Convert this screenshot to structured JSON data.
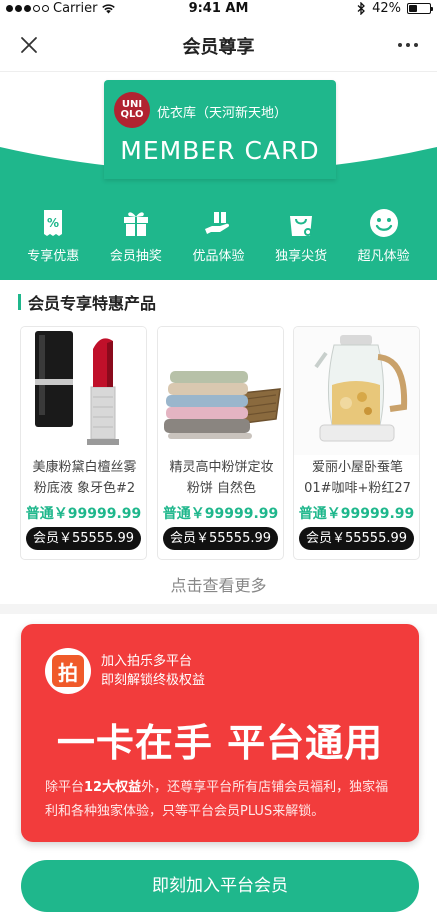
{
  "status_bar": {
    "carrier": "Carrier",
    "time": "9:41 AM",
    "battery": "42%",
    "battery_level": 0.42
  },
  "nav": {
    "title": "会员尊享",
    "close_icon": "close-icon",
    "more_icon": "more-icon"
  },
  "hero": {
    "brand_logo_line1": "UNI",
    "brand_logo_line2": "QLO",
    "store_name": "优衣库（天河新天地）",
    "card_title": "MEMBER CARD",
    "accent_color": "#1fb78c",
    "benefits": [
      {
        "icon": "discount-icon",
        "label": "专享优惠"
      },
      {
        "icon": "gift-icon",
        "label": "会员抽奖"
      },
      {
        "icon": "hand-gift-icon",
        "label": "优品体验"
      },
      {
        "icon": "shopping-bag-icon",
        "label": "独享尖货"
      },
      {
        "icon": "smile-icon",
        "label": "超凡体验"
      }
    ]
  },
  "products_section": {
    "title": "会员专享特惠产品",
    "see_more": "点击查看更多",
    "products": [
      {
        "image": "lipstick",
        "name": "美康粉黛白檀丝雾粉底液 象牙色#2",
        "regular_price": "普通￥99999.99",
        "member_price": "会员￥55555.99"
      },
      {
        "image": "towels",
        "name": "精灵高中粉饼定妆粉饼 自然色",
        "regular_price": "普通￥99999.99",
        "member_price": "会员￥55555.99"
      },
      {
        "image": "kettle",
        "name": "爱丽小屋卧蚕笔01#咖啡+粉红27",
        "regular_price": "普通￥99999.99",
        "member_price": "会员￥55555.99"
      }
    ]
  },
  "promo": {
    "logo_char": "拍",
    "intro_line1": "加入拍乐多平台",
    "intro_line2": "即刻解锁终极权益",
    "slogan": "一卡在手 平台通用",
    "desc_prefix": "除平台",
    "desc_highlight": "12大权益",
    "desc_rest": "外，还尊享平台所有店铺会员福利，独家福利和各种独家体验，只等平台会员PLUS来解锁。",
    "color": "#f23c3c"
  },
  "join_button": "即刻加入平台会员"
}
